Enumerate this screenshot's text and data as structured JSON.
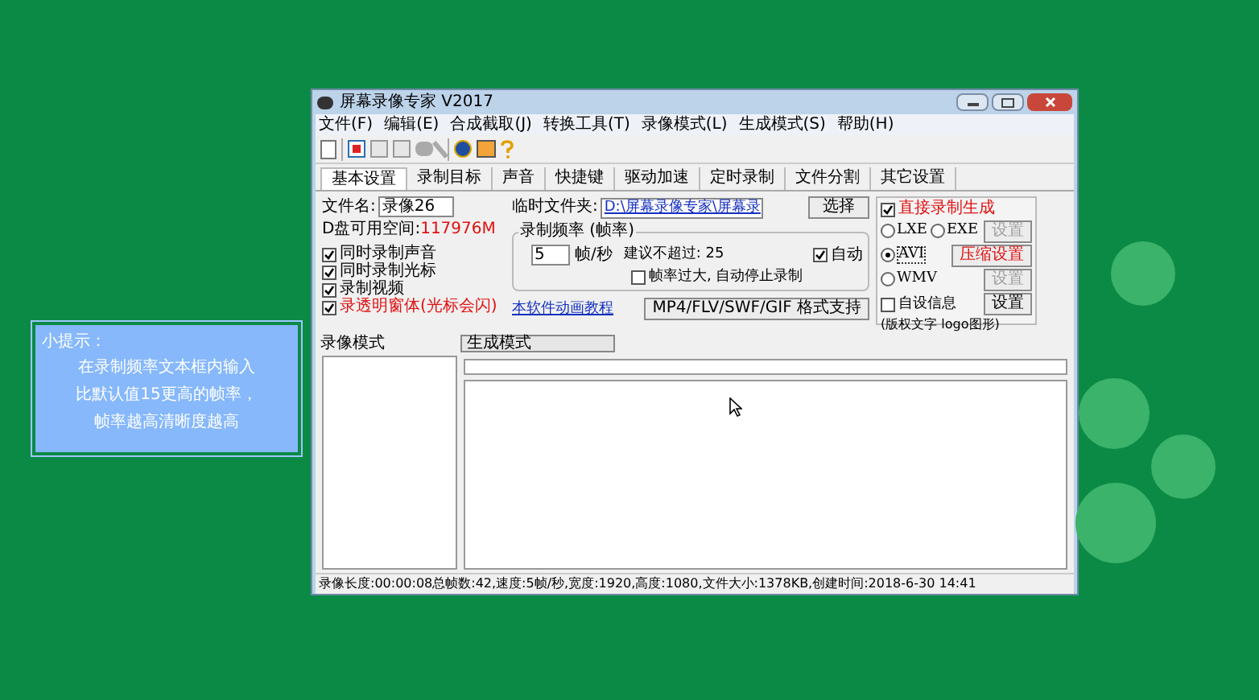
{
  "tip": {
    "title": "小提示：",
    "lines": [
      "在录制频率文本框内输入",
      "比默认值15更高的帧率，",
      "帧率越高清晰度越高"
    ]
  },
  "window": {
    "title": "屏幕录像专家 V2017"
  },
  "menu": [
    "文件(F)",
    "编辑(E)",
    "合成截取(J)",
    "转换工具(T)",
    "录像模式(L)",
    "生成模式(S)",
    "帮助(H)"
  ],
  "tabs": [
    {
      "label": "基本设置",
      "selected": true
    },
    {
      "label": "录制目标",
      "selected": false
    },
    {
      "label": "声音",
      "selected": false
    },
    {
      "label": "快捷键",
      "selected": false
    },
    {
      "label": "驱动加速",
      "selected": false
    },
    {
      "label": "定时录制",
      "selected": false
    },
    {
      "label": "文件分割",
      "selected": false
    },
    {
      "label": "其它设置",
      "selected": false
    }
  ],
  "basic": {
    "filename_label": "文件名:",
    "filename": "录像26",
    "disk_label": "D盘可用空间:",
    "disk_free": "117976M",
    "options": [
      {
        "label": "同时录制声音",
        "checked": true,
        "warning": false
      },
      {
        "label": "同时录制光标",
        "checked": true,
        "warning": false
      },
      {
        "label": "录制视频",
        "checked": true,
        "warning": false
      },
      {
        "label": "录透明窗体(光标会闪)",
        "checked": true,
        "warning": true
      }
    ],
    "temp_label": "临时文件夹:",
    "temp_path": "D:\\屏幕录像专家\\屏幕录",
    "choose_button": "选择",
    "rate_group": {
      "title": "录制频率 (帧率)",
      "value": "5",
      "unit": "帧/秒",
      "hint": "建议不超过: 25",
      "auto": {
        "label": "自动",
        "checked": true
      },
      "autostop": {
        "label": "帧率过大, 自动停止录制",
        "checked": false
      }
    },
    "tutorial_link": "本软件动画教程",
    "format_button": "MP4/FLV/SWF/GIF 格式支持"
  },
  "direct": {
    "label": "直接录制生成",
    "checked": true,
    "formats": [
      {
        "label": "LXE",
        "selected": false
      },
      {
        "label": "EXE",
        "selected": false
      },
      {
        "label": "AVI",
        "selected": true
      },
      {
        "label": "WMV",
        "selected": false
      }
    ],
    "format_buttons": [
      {
        "label": "设置",
        "disabled": true
      },
      {
        "label": "压缩设置",
        "disabled": false
      },
      {
        "label": "设置",
        "disabled": true
      }
    ],
    "custom_info": {
      "label": "自设信息",
      "checked": false,
      "button": "设置",
      "note": "(版权文字 logo图形)"
    }
  },
  "record_mode": {
    "title": "录像模式"
  },
  "output_mode": {
    "title": "生成模式"
  },
  "status_bar": "录像长度:00:00:08总帧数:42,速度:5帧/秒,宽度:1920,高度:1080,文件大小:1378KB,创建时间:2018-6-30 14:41"
}
